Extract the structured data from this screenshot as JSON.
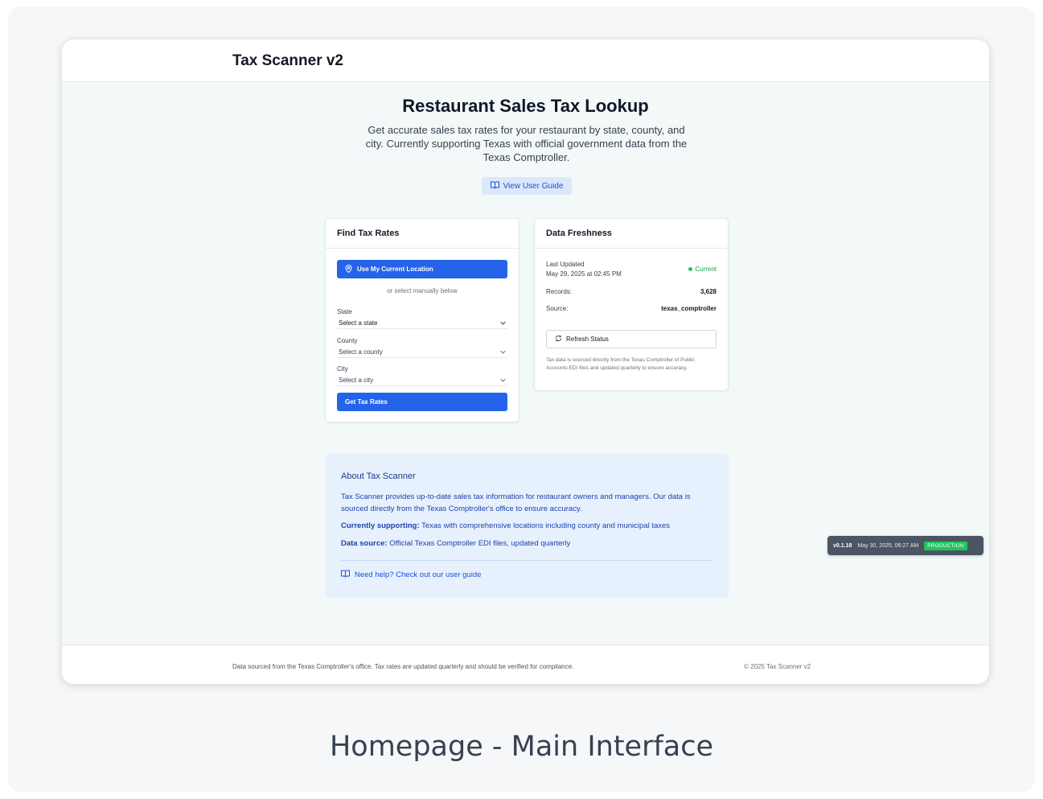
{
  "app": {
    "title": "Tax Scanner v2"
  },
  "hero": {
    "title": "Restaurant Sales Tax Lookup",
    "description": "Get accurate sales tax rates for your restaurant by state, county, and city. Currently supporting Texas with official government data from the Texas Comptroller.",
    "guide_button": "View User Guide"
  },
  "find": {
    "title": "Find Tax Rates",
    "location_button": "Use My Current Location",
    "or_text": "or select manually below",
    "state_label": "State",
    "state_value": "Select a state",
    "county_label": "County",
    "county_value": "Select a county",
    "city_label": "City",
    "city_value": "Select a city",
    "submit_button": "Get Tax Rates"
  },
  "freshness": {
    "title": "Data Freshness",
    "last_updated_label": "Last Updated",
    "last_updated_value": "May 29, 2025 at 02:45 PM",
    "status": "Current",
    "records_label": "Records:",
    "records_value": "3,628",
    "source_label": "Source:",
    "source_value": "texas_comptroller",
    "refresh_button": "Refresh Status",
    "note": "Tax data is sourced directly from the Texas Comptroller of Public Accounts EDI files and updated quarterly to ensure accuracy."
  },
  "about": {
    "title": "About Tax Scanner",
    "para1": "Tax Scanner provides up-to-date sales tax information for restaurant owners and managers. Our data is sourced directly from the Texas Comptroller's office to ensure accuracy.",
    "supporting_label": "Currently supporting:",
    "supporting_text": " Texas with comprehensive locations including county and municipal taxes",
    "source_label": "Data source:",
    "source_text": " Official Texas Comptroller EDI files, updated quarterly",
    "help_link": "Need help? Check out our user guide"
  },
  "version": {
    "number": "v0.1.18",
    "date": "May 30, 2025, 06:27 AM",
    "env": "PRODUCTION"
  },
  "footer": {
    "left": "Data sourced from the Texas Comptroller's office. Tax rates are updated quarterly and should be verified for compliance.",
    "right": "© 2025 Tax Scanner v2"
  },
  "caption": "Homepage - Main Interface",
  "colors": {
    "primary": "#2563eb",
    "success": "#22c55e",
    "about_bg": "#e7f1fd"
  }
}
